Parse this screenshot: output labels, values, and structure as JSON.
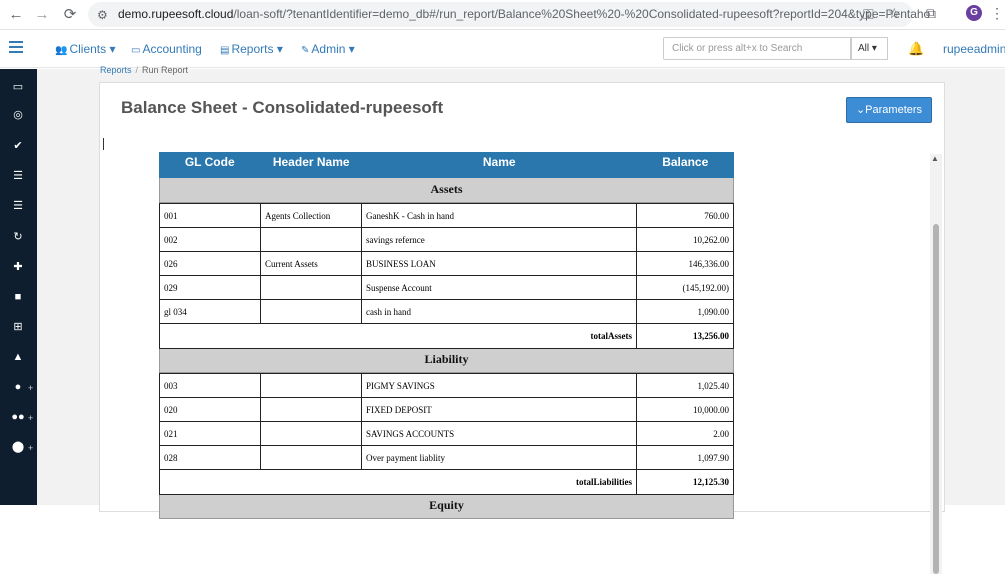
{
  "browser": {
    "url_host": "demo.rupeesoft.cloud",
    "url_rest": "/loan-soft/?tenantIdentifier=demo_db#/run_report/Balance%20Sheet%20-%20Consolidated-rupeesoft?reportId=204&type=Pentaho",
    "profile_initial": "G"
  },
  "nav": {
    "clients": "Clients",
    "accounting": "Accounting",
    "reports": "Reports",
    "admin": "Admin",
    "search_placeholder": "Click or press alt+x to Search",
    "search_scope": "All",
    "user": "rupeeadmin"
  },
  "breadcrumb": {
    "parent": "Reports",
    "current": "Run Report"
  },
  "page": {
    "title": "Balance Sheet - Consolidated-rupeesoft",
    "params_button": "Parameters"
  },
  "report": {
    "columns": [
      "GL Code",
      "Header Name",
      "Name",
      "Balance"
    ],
    "assets": {
      "title": "Assets",
      "rows": [
        {
          "code": "001",
          "header": "Agents Collection",
          "name": "GaneshK - Cash in hand",
          "balance": "760.00"
        },
        {
          "code": "002",
          "header": "",
          "name": "savings refernce",
          "balance": "10,262.00"
        },
        {
          "code": "026",
          "header": "Current Assets",
          "name": "BUSINESS LOAN",
          "balance": "146,336.00"
        },
        {
          "code": "029",
          "header": "",
          "name": "Suspense Account",
          "balance": "(145,192.00)"
        },
        {
          "code": "gl 034",
          "header": "",
          "name": "cash in hand",
          "balance": "1,090.00"
        }
      ],
      "total_label": "totalAssets",
      "total_value": "13,256.00"
    },
    "liability": {
      "title": "Liability",
      "rows": [
        {
          "code": "003",
          "header": "",
          "name": "PIGMY SAVINGS",
          "balance": "1,025.40"
        },
        {
          "code": "020",
          "header": "",
          "name": "FIXED DEPOSIT",
          "balance": "10,000.00"
        },
        {
          "code": "021",
          "header": "",
          "name": "SAVINGS ACCOUNTS",
          "balance": "2.00"
        },
        {
          "code": "028",
          "header": "",
          "name": "Over payment liablity",
          "balance": "1,097.90"
        }
      ],
      "total_label": "totalLiabilities",
      "total_value": "12,125.30"
    },
    "equity_title": "Equity"
  },
  "icons": {
    "back": "arrow-left-icon",
    "forward": "arrow-right-icon",
    "reload": "reload-icon",
    "menu": "hamburger-icon",
    "notifications": "bell-icon"
  }
}
